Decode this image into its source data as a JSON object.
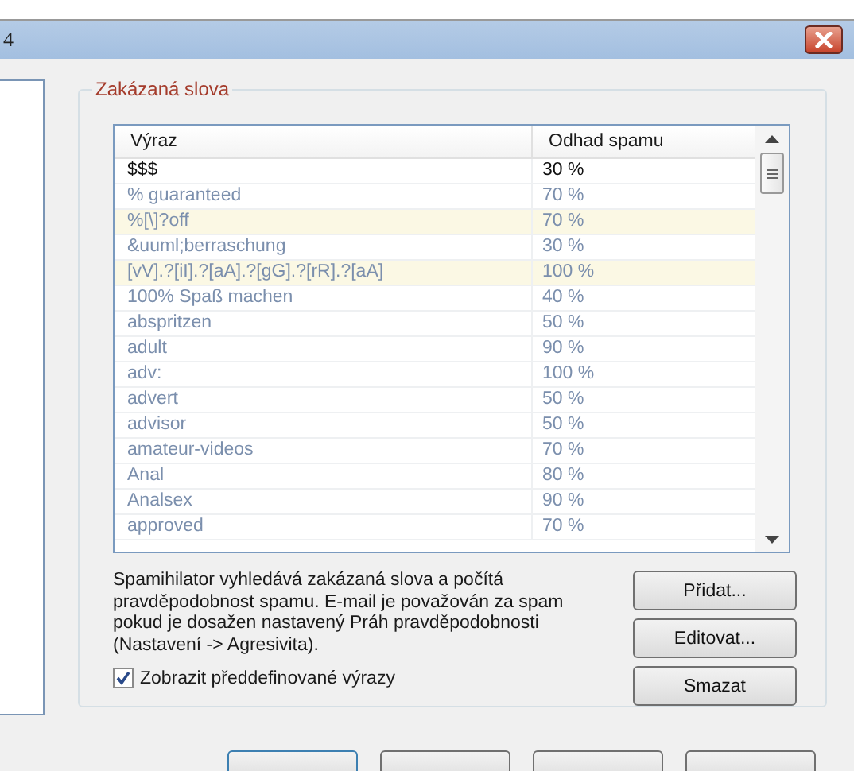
{
  "window": {
    "title": "4"
  },
  "group": {
    "title": "Zakázaná slova"
  },
  "table": {
    "columns": [
      "Výraz",
      "Odhad spamu"
    ],
    "rows": [
      {
        "expression": "$$$",
        "estimate": "30 %",
        "kind": "custom",
        "highlighted": false
      },
      {
        "expression": "% guaranteed",
        "estimate": "70 %",
        "kind": "predefined",
        "highlighted": false
      },
      {
        "expression": "%[\\]?off",
        "estimate": "70 %",
        "kind": "predefined",
        "highlighted": true
      },
      {
        "expression": "&uuml;berraschung",
        "estimate": "30 %",
        "kind": "predefined",
        "highlighted": false
      },
      {
        "expression": "[vV].?[iI].?[aA].?[gG].?[rR].?[aA]",
        "estimate": "100 %",
        "kind": "predefined",
        "highlighted": true
      },
      {
        "expression": "100% Spaß machen",
        "estimate": "40 %",
        "kind": "predefined",
        "highlighted": false
      },
      {
        "expression": "abspritzen",
        "estimate": "50 %",
        "kind": "predefined",
        "highlighted": false
      },
      {
        "expression": "adult",
        "estimate": "90 %",
        "kind": "predefined",
        "highlighted": false
      },
      {
        "expression": "adv:",
        "estimate": "100 %",
        "kind": "predefined",
        "highlighted": false
      },
      {
        "expression": "advert",
        "estimate": "50 %",
        "kind": "predefined",
        "highlighted": false
      },
      {
        "expression": "advisor",
        "estimate": "50 %",
        "kind": "predefined",
        "highlighted": false
      },
      {
        "expression": "amateur-videos",
        "estimate": "70 %",
        "kind": "predefined",
        "highlighted": false
      },
      {
        "expression": "Anal",
        "estimate": "80 %",
        "kind": "predefined",
        "highlighted": false
      },
      {
        "expression": "Analsex",
        "estimate": "90 %",
        "kind": "predefined",
        "highlighted": false
      },
      {
        "expression": "approved",
        "estimate": "70 %",
        "kind": "predefined",
        "highlighted": false
      }
    ]
  },
  "description": "Spamihilator vyhledává zakázaná slova a počítá pravděpodobnost spamu. E-mail je považován za spam pokud je dosažen nastavený Práh pravděpodobnosti (Nastavení -> Agresivita).",
  "show_predefined": {
    "label": "Zobrazit předdefinované výrazy",
    "checked": true
  },
  "buttons": [
    "Přidat...",
    "Editovat...",
    "Smazat"
  ]
}
